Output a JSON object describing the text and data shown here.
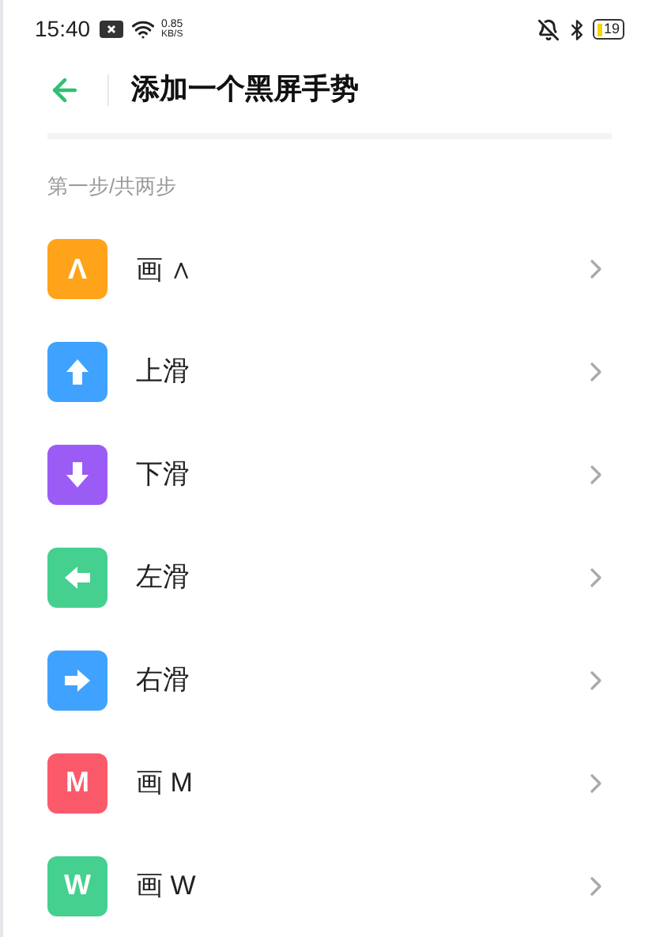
{
  "status_bar": {
    "time": "15:40",
    "speed_value": "0.85",
    "speed_unit": "KB/S",
    "battery": "19"
  },
  "header": {
    "title": "添加一个黑屏手势"
  },
  "section": {
    "label": "第一步/共两步"
  },
  "gestures": [
    {
      "kind": "letter",
      "glyph": "Λ",
      "label": "画 ∧",
      "color": "#ffa31a"
    },
    {
      "kind": "up",
      "label": "上滑",
      "color": "#3fa2ff"
    },
    {
      "kind": "down",
      "label": "下滑",
      "color": "#9b5cf6"
    },
    {
      "kind": "left",
      "label": "左滑",
      "color": "#45d08f"
    },
    {
      "kind": "right",
      "label": "右滑",
      "color": "#3fa2ff"
    },
    {
      "kind": "letter",
      "glyph": "M",
      "label": "画 M",
      "color": "#fb5a6b"
    },
    {
      "kind": "letter",
      "glyph": "W",
      "label": "画 W",
      "color": "#45d08f"
    }
  ]
}
